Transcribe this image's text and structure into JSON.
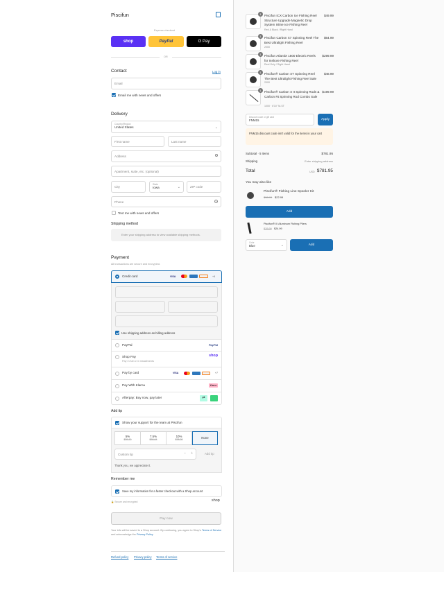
{
  "store": {
    "name": "Piscifun"
  },
  "express": {
    "label": "Express checkout",
    "shop_label": "shop",
    "paypal_label": "PayPal",
    "gpay_label": "G Pay",
    "or_label": "OR"
  },
  "contact": {
    "title": "Contact",
    "login_link": "Log in",
    "email_placeholder": "Email",
    "news_label": "Email me with news and offers"
  },
  "delivery": {
    "title": "Delivery",
    "country_label": "Country/Region",
    "country_value": "United States",
    "first_name_placeholder": "First name",
    "last_name_placeholder": "Last name",
    "address_placeholder": "Address",
    "apartment_placeholder": "Apartment, suite, etc. (optional)",
    "city_placeholder": "City",
    "state_label": "State",
    "state_value": "Iowa",
    "zip_placeholder": "ZIP code",
    "phone_placeholder": "Phone",
    "text_label": "Text me with news and offers"
  },
  "shipping_method": {
    "title": "Shipping method",
    "note": "Enter your shipping address to view available shipping methods."
  },
  "payment": {
    "title": "Payment",
    "subtitle": "All transactions are secure and encrypted.",
    "credit_card_label": "Credit card",
    "more_cards": "+4",
    "billing_label": "Use shipping address as billing address",
    "options": [
      {
        "label": "PayPal",
        "sublabel": "",
        "badge": "PayPal"
      },
      {
        "label": "Shop Pay",
        "sublabel": "Pay in full or in installments",
        "badge": "shop"
      },
      {
        "label": "Pay by card",
        "sublabel": "",
        "badge": "+7"
      },
      {
        "label": "Pay With Klarna",
        "sublabel": "",
        "badge": "Klarna"
      },
      {
        "label": "Afterpay: Buy now, pay later",
        "sublabel": "",
        "badge": ""
      }
    ]
  },
  "tip": {
    "title": "Add tip",
    "support_label": "Show your support for the team at Piscifun",
    "options": [
      {
        "pct": "5%",
        "amt": "$39.10"
      },
      {
        "pct": "7.5%",
        "amt": "$58.64"
      },
      {
        "pct": "10%",
        "amt": "$78.20"
      },
      {
        "pct": "None",
        "amt": ""
      }
    ],
    "custom_placeholder": "Custom tip",
    "add_label": "Add tip",
    "thanks": "Thank you, we appreciate it."
  },
  "remember": {
    "title": "Remember me",
    "save_label": "Save my information for a faster checkout with a Shop account",
    "secure_label": "Secure and encrypted",
    "shop_label": "shop"
  },
  "pay_button": "Pay now",
  "legal": {
    "text1": "Your info will be saved to a Shop account. By continuing, you agree to Shop's",
    "terms": "Terms of Service",
    "and": "and acknowledge the",
    "privacy": "Privacy Policy",
    "end": "."
  },
  "footer": {
    "links": [
      "Refund policy",
      "Privacy policy",
      "Terms of service"
    ]
  },
  "cart": {
    "items": [
      {
        "qty": "1",
        "title": "Piscifun ICX Carbon Ice Fishing Reel Structure Upgrade Magnetic Drop System Inline Ice Fishing Reel",
        "variant": "Red & Black / Right Hand",
        "price": "$49.99"
      },
      {
        "qty": "1",
        "title": "Piscifun Carbon X7 Spinning Reel The Best Ultralight Fishing Reel",
        "variant": "2000",
        "price": "$64.99"
      },
      {
        "qty": "1",
        "title": "Piscifun AtlantiX 1500 Electric Reels for Inshore Fishing Reel",
        "variant": "Reel Only / Right Hand",
        "price": "$299.99"
      },
      {
        "qty": "1",
        "title": "Piscifun® Carbon XT Spinning Reel The Best Ultralight Fishing Reel Sale",
        "variant": "2000",
        "price": "$48.99"
      },
      {
        "qty": "1",
        "title": "Piscifun® Carbon X II Spinning Rods & Carbon Rt Spinning Rod Combo Sale",
        "variant": "1000 · 6'10\" M-ST",
        "price": "$199.99"
      }
    ],
    "discount_label": "Discount code or gift card",
    "discount_value": "FNM15",
    "apply_label": "Apply",
    "error": "FNM15 discount code isn't valid for the items in your cart",
    "subtotal_label": "Subtotal · 5 items",
    "subtotal_value": "$781.95",
    "shipping_label": "Shipping",
    "shipping_value": "Enter shipping address",
    "total_label": "Total",
    "currency": "USD",
    "total_value": "$781.95"
  },
  "upsell": {
    "title": "You may also like",
    "items": [
      {
        "title": "Piscifun® Fishing Line Spooler Kit",
        "old_price": "$38.99",
        "price": "$22.99",
        "add_label": "Add"
      },
      {
        "title": "Piscifun® III Aluminum Fishing Pliers",
        "old_price": "$29.99",
        "price": "$24.99",
        "color_label": "Color",
        "color_value": "Blue",
        "add_label": "Add"
      }
    ]
  },
  "colors": {
    "accent": "#1a6fb4",
    "shop": "#5a31f4",
    "paypal": "#ffc439",
    "error_bg": "#fff4e5"
  }
}
